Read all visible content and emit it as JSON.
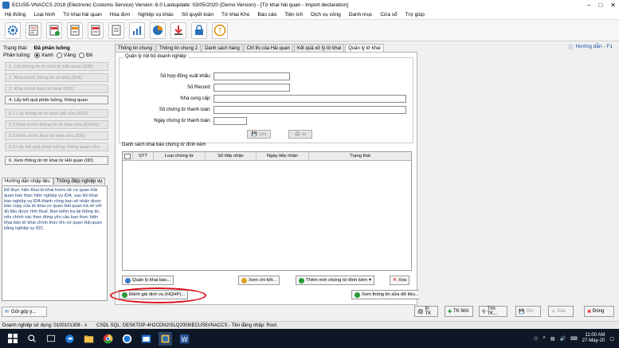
{
  "window": {
    "title": "ECUS5-VNACCS 2018 (Electronic Customs Service) Version: 6.0 Lastupdate: 03/05/2020 (Demo Version) - [Tờ khai hải quan - Import declaration]"
  },
  "menu": [
    "Hệ thống",
    "Loại hình",
    "Tờ khai hải quan",
    "Hóa đơn",
    "Nghiệp vụ khác",
    "Số quyết toán",
    "Tờ khai Kho",
    "Báo cáo",
    "Tiện ích",
    "Dịch vụ công",
    "Danh mục",
    "Cửa sổ",
    "Trợ giúp"
  ],
  "help_link": "Hướng dẫn - F1",
  "left": {
    "status_label": "Trạng thái:",
    "status_value": "Đã phân luồng",
    "routing_label": "Phân luồng:",
    "routing_options": [
      "Xanh",
      "Vàng",
      "Đỏ"
    ],
    "steps": [
      "1. Lấy thông tin tờ khai từ Hải quan (IDB)",
      "2. Khai trước thông tin tờ khai (IDA)",
      "3. Khai chính thức tờ khai (IDC)",
      "4. Lấy kết quả phân luồng, thông quan",
      "5.1 Lấy thông tin tờ khai (để sửa (IDD)",
      "5.2 Khai trước thông tin tờ khai sửa (IDA01)",
      "5.3 Khai chính thức tờ khai sửa (IDE)",
      "5.4 Lấy kết quả phân luồng, thông quan sửa",
      "6. Xem thông tin tờ khai từ Hải quan (IID)"
    ],
    "guide_tabs": [
      "Hướng dẫn nhập liệu",
      "Thông điệp nghiệp vụ"
    ],
    "guide_text": "Để thực hiện khai tờ khai trước tiề cơ quan Hải quan ban thực hiện nghiệp vụ IDA, sau khi khai báo nghiệp vụ IDA thành công bạn sẽ nhận được bản copy của tờ khai cơ quan Hải quan trả về với đủ liệu được tính thuế. Bạn kiểm tra lại thông tin, nếu chính xác theo đúng yêu cầu bạn thực hiện khai báo tờ khai chính thức lên cơ quan Hải quan bằng nghiệp vụ IDC.",
    "feedback": "Gửi góp ý..."
  },
  "tabs": [
    "Thông tin chung",
    "Thông tin chung 2",
    "Danh sách hàng",
    "Chỉ thị của Hải quan",
    "Kết quả xử lý tờ khai",
    "Quản lý tờ khai"
  ],
  "form": {
    "legend": "Quản lý nội bộ doanh nghiệp",
    "fields": [
      "Số hợp đồng xuất khẩu:",
      "Số Record:",
      "Nhà cung cấp:",
      "Số chứng từ thanh toán:",
      "Ngày chứng từ thanh toán:"
    ],
    "save": "Ghi",
    "print": "In"
  },
  "grid": {
    "title": "Danh sách khai báo chứng từ đính kèm",
    "columns": [
      "STT",
      "Loại chứng từ",
      "Số tiếp nhận",
      "Ngày tiếp nhận",
      "Trạng thái"
    ]
  },
  "actions": {
    "manage": "Quản lý khai báo...",
    "view_detail": "Xem chi tiết...",
    "add_new": "Thêm mới chứng từ đính kèm",
    "delete": "Xóa",
    "evaluate": "Đánh giá dịch vụ (HQHP)...",
    "view_edits": "Xem thông tin sửa dữ liệu..."
  },
  "bottom": {
    "print_tk": "In TK",
    "new_tk": "TK Mới",
    "find_tk": "Tìm TK...",
    "save": "Ghi",
    "delete": "Xóa",
    "close": "Đóng"
  },
  "status": {
    "company": "Doanh nghiệp sử dụng: 0100101308 - x",
    "sql": "CSDL SQL: DESKTOP-4H2CDN2\\SLQ2008\\ECUS5VNACCS - Tên đăng nhập: Root"
  },
  "clock": {
    "time": "11:00 AM",
    "date": "27-May-20"
  },
  "colors": {
    "highlight": "#d9111a",
    "taskbar": "#0d1726"
  }
}
